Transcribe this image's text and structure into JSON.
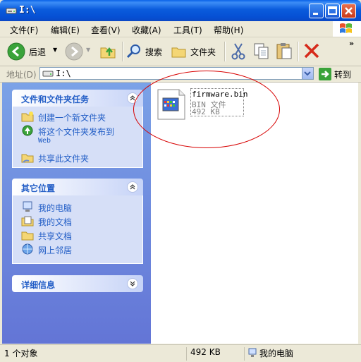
{
  "window": {
    "title": "I:\\"
  },
  "menu": [
    "文件(F)",
    "编辑(E)",
    "查看(V)",
    "收藏(A)",
    "工具(T)",
    "帮助(H)"
  ],
  "toolbar": {
    "back_label": "后退",
    "search_label": "搜索",
    "folders_label": "文件夹"
  },
  "address": {
    "label": "地址(D)",
    "value": "I:\\",
    "go_label": "转到"
  },
  "tasks_panel": {
    "title": "文件和文件夹任务",
    "items": [
      {
        "label": "创建一个新文件夹",
        "icon": "new-folder-icon"
      },
      {
        "label": "将这个文件夹发布到",
        "sub": "Web",
        "icon": "publish-web-icon"
      },
      {
        "label": "共享此文件夹",
        "icon": "share-folder-icon"
      }
    ]
  },
  "places_panel": {
    "title": "其它位置",
    "items": [
      {
        "label": "我的电脑",
        "icon": "my-computer-icon"
      },
      {
        "label": "我的文档",
        "icon": "my-documents-icon"
      },
      {
        "label": "共享文档",
        "icon": "shared-documents-icon"
      },
      {
        "label": "网上邻居",
        "icon": "network-places-icon"
      }
    ]
  },
  "details_panel": {
    "title": "详细信息"
  },
  "file": {
    "name": "firmware.bin",
    "type": "BIN 文件",
    "size": "492 KB"
  },
  "status": {
    "objects": "1 个对象",
    "size": "492 KB",
    "location": "我的电脑"
  },
  "colors": {
    "title_bar": "#0A5BDC",
    "task_pane": "#6375d6",
    "panel_body": "#D6DFF7",
    "link": "#215dc6",
    "annotation": "#d70000"
  }
}
